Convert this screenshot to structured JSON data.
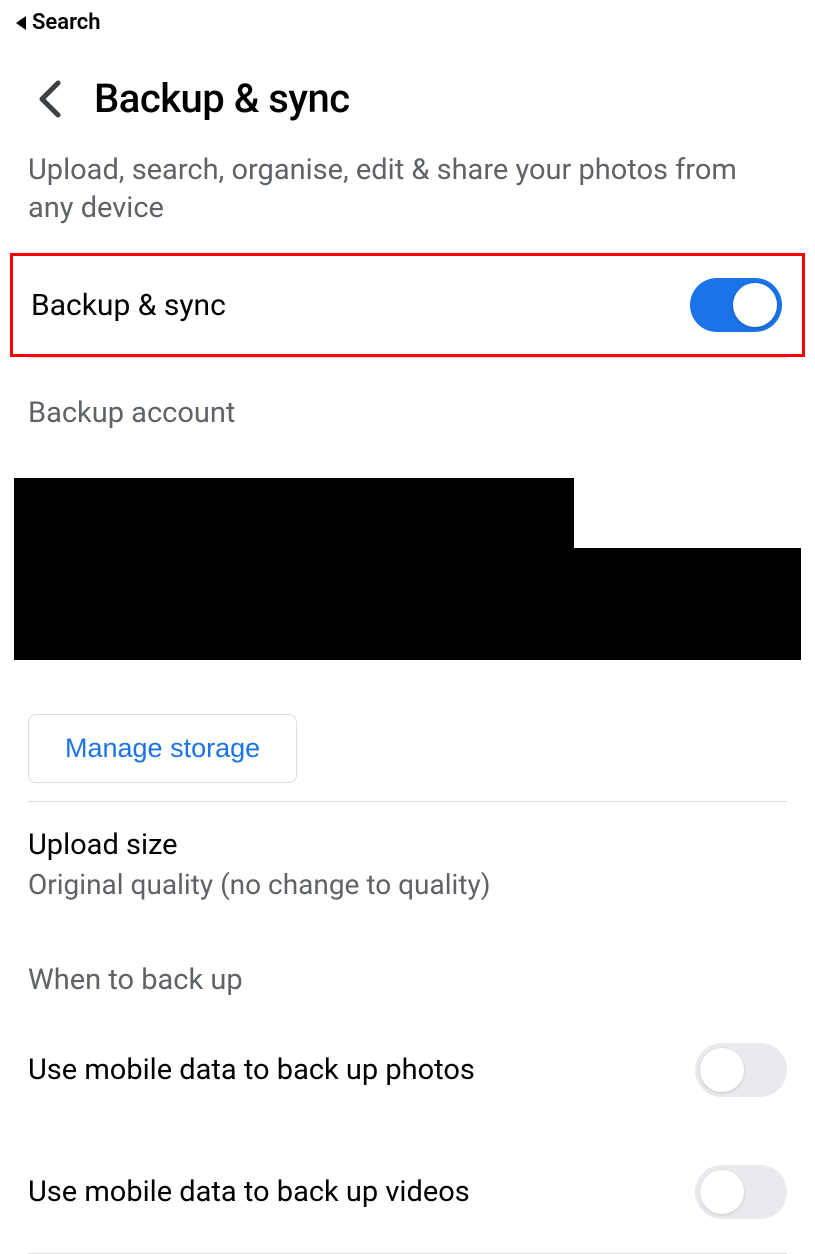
{
  "statusBar": {
    "backLabel": "Search"
  },
  "header": {
    "title": "Backup & sync"
  },
  "description": "Upload, search, organise, edit & share your photos from any device",
  "backupToggle": {
    "label": "Backup & sync",
    "on": true
  },
  "backupAccount": {
    "label": "Backup account"
  },
  "manageStorage": {
    "label": "Manage storage"
  },
  "uploadSize": {
    "title": "Upload size",
    "subtitle": "Original quality (no change to quality)"
  },
  "whenToBackUp": {
    "label": "When to back up"
  },
  "mobilePhotos": {
    "label": "Use mobile data to back up photos",
    "on": false
  },
  "mobileVideos": {
    "label": "Use mobile data to back up videos",
    "on": false
  }
}
